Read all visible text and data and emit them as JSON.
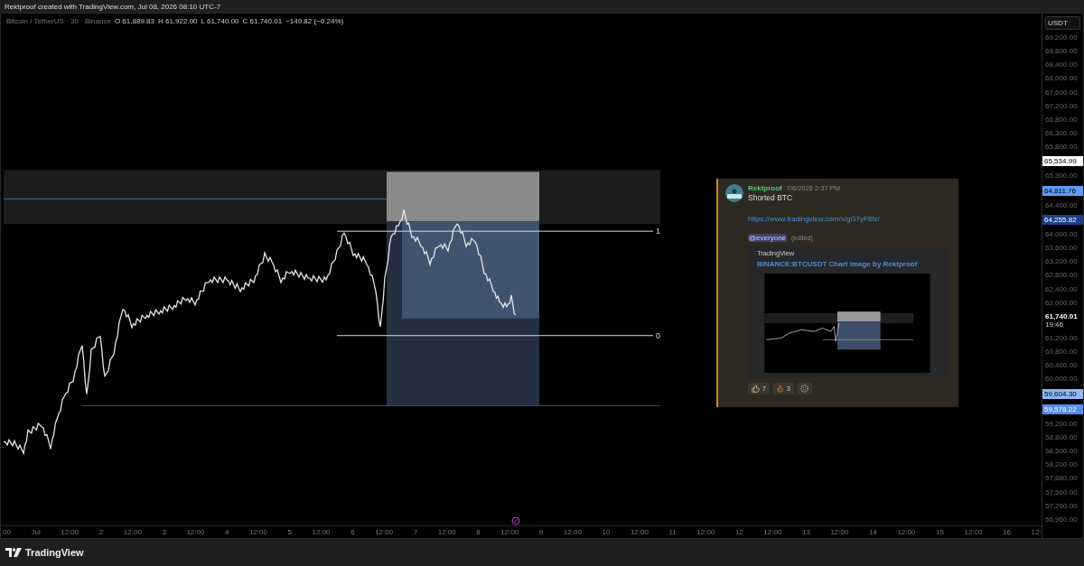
{
  "header": {
    "caption": "Rektproof created with TradingView.com, Jul 08, 2026 08:10 UTC-7"
  },
  "legend": {
    "symbol": "Bitcoin / TetherUS · 30 · Binance",
    "ohlc": [
      {
        "label": "O",
        "value": "61,889.83"
      },
      {
        "label": "H",
        "value": "61,922.00"
      },
      {
        "label": "L",
        "value": "61,740.00"
      },
      {
        "label": "C",
        "value": "61,740.01"
      }
    ],
    "change": "−149.82 (−0.24%)"
  },
  "drawings": {
    "level_labels": [
      "1",
      "0"
    ]
  },
  "price_axis": {
    "currency": "USDT",
    "labels": [
      {
        "kind": "tick",
        "text": "69,200.00"
      },
      {
        "kind": "tick",
        "text": "68,800.00"
      },
      {
        "kind": "tick",
        "text": "68,400.00"
      },
      {
        "kind": "tick",
        "text": "68,000.00"
      },
      {
        "kind": "tick",
        "text": "67,600.00"
      },
      {
        "kind": "tick",
        "text": "67,200.00"
      },
      {
        "kind": "tick",
        "text": "66,800.00"
      },
      {
        "kind": "tick",
        "text": "66,300.00"
      },
      {
        "kind": "tick",
        "text": "65,800.00"
      },
      {
        "kind": "badge",
        "text": "65,534.99",
        "color": "#ffffff"
      },
      {
        "kind": "tick",
        "text": "65,300.00"
      },
      {
        "kind": "badge",
        "text": "64,811.76",
        "color": "#5b9cf6"
      },
      {
        "kind": "tick",
        "text": "64,400.00"
      },
      {
        "kind": "badge",
        "text": "64,255.82",
        "color": "#1e3f8a"
      },
      {
        "kind": "tick",
        "text": "64,000.00"
      },
      {
        "kind": "tick",
        "text": "63,600.00"
      },
      {
        "kind": "tick",
        "text": "63,200.00"
      },
      {
        "kind": "tick",
        "text": "62,800.00"
      },
      {
        "kind": "tick",
        "text": "62,400.00"
      },
      {
        "kind": "tick",
        "text": "62,000.00"
      },
      {
        "kind": "last",
        "text": "61,740.01",
        "sub": "19:46"
      },
      {
        "kind": "tick",
        "text": "61,200.00"
      },
      {
        "kind": "tick",
        "text": "60,800.00"
      },
      {
        "kind": "tick",
        "text": "60,400.00"
      },
      {
        "kind": "tick",
        "text": "60,000.00"
      },
      {
        "kind": "badge",
        "text": "59,604.30",
        "color": "#8fb8f5"
      },
      {
        "kind": "badge",
        "text": "59,578.22",
        "color": "#5b8def"
      },
      {
        "kind": "tick",
        "text": "59,200.00"
      },
      {
        "kind": "tick",
        "text": "58,800.00"
      },
      {
        "kind": "tick",
        "text": "58,500.00"
      },
      {
        "kind": "tick",
        "text": "58,200.00"
      },
      {
        "kind": "tick",
        "text": "57,880.00"
      },
      {
        "kind": "tick",
        "text": "57,560.00"
      },
      {
        "kind": "tick",
        "text": "57,260.00"
      },
      {
        "kind": "tick",
        "text": "56,960.00"
      }
    ]
  },
  "time_axis": {
    "labels": [
      "00",
      "Jul",
      "12:00",
      "2",
      "12:00",
      "3",
      "12:00",
      "4",
      "12:00",
      "5",
      "12:00",
      "6",
      "12:00",
      "7",
      "12:00",
      "8",
      "12:00",
      "9",
      "12:00",
      "10",
      "12:00",
      "11",
      "12:00",
      "12",
      "12:00",
      "13",
      "12:00",
      "14",
      "12:00",
      "15",
      "12:00",
      "16",
      "12:"
    ]
  },
  "message": {
    "author": "Rektproof",
    "timestamp": "7/6/2026 2:37 PM",
    "text": "Shorted BTC",
    "link": "https://www.tradingview.com/x/gG7yF6fz/",
    "mention": "@everyone",
    "edited": "(edited)",
    "embed": {
      "provider": "TradingView",
      "title": "BINANCE:BTCUSDT Chart Image by Rektproof"
    },
    "reactions": [
      {
        "kind": "thumbs_up",
        "count": "7"
      },
      {
        "kind": "fire",
        "count": "3"
      }
    ]
  },
  "footer": {
    "brand": "TradingView"
  }
}
